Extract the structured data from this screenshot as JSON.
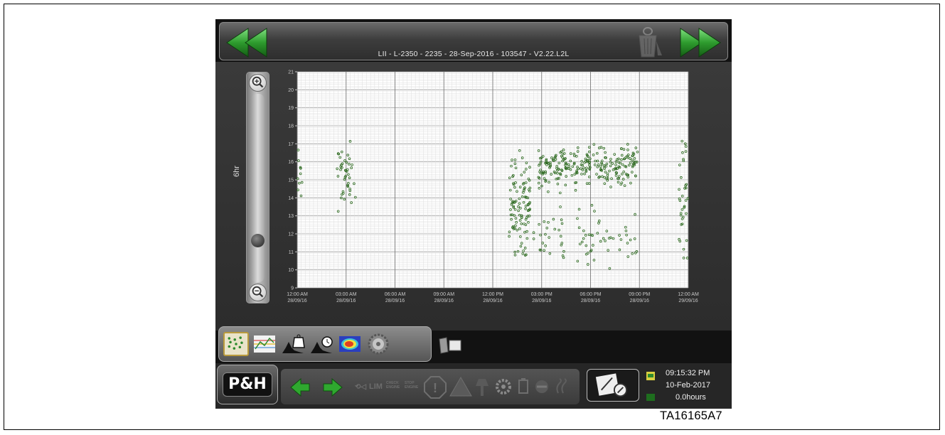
{
  "header": {
    "title": "LII - L-2350 - 2235 - 28-Sep-2016 - 103547 - V2.22.L2L",
    "icons": [
      "arrow-left-icon",
      "trash-icon",
      "arrow-right-icon"
    ]
  },
  "zoom": {
    "label": "6hr",
    "level": 0.8
  },
  "chart_data": {
    "type": "scatter",
    "title": "",
    "xlabel": "",
    "ylabel": "",
    "ylim": [
      9,
      21
    ],
    "y_ticks": [
      "9",
      "10",
      "11",
      "12",
      "13",
      "14",
      "15",
      "16",
      "17",
      "18",
      "19",
      "20",
      "21"
    ],
    "x_ticks": [
      {
        "time": "12:00 AM",
        "date": "28/09/16"
      },
      {
        "time": "03:00 AM",
        "date": "28/09/16"
      },
      {
        "time": "06:00 AM",
        "date": "28/09/16"
      },
      {
        "time": "09:00 AM",
        "date": "28/09/16"
      },
      {
        "time": "12:00 PM",
        "date": "28/09/16"
      },
      {
        "time": "03:00 PM",
        "date": "28/09/16"
      },
      {
        "time": "06:00 PM",
        "date": "28/09/16"
      },
      {
        "time": "09:00 PM",
        "date": "28/09/16"
      },
      {
        "time": "12:00 AM",
        "date": "29/09/16"
      }
    ],
    "xlim_hours": [
      0,
      24
    ],
    "grid": true,
    "marker_color": "#2f6b22",
    "clusters": [
      {
        "x_range": [
          0.0,
          0.3
        ],
        "y_range": [
          12.4,
          17.5
        ],
        "count": 10
      },
      {
        "x_range": [
          2.4,
          3.6
        ],
        "y_range": [
          12.6,
          17.8
        ],
        "count": 45
      },
      {
        "x_range": [
          13.0,
          14.3
        ],
        "y_range": [
          9.6,
          17.4
        ],
        "count": 110
      },
      {
        "x_range": [
          14.8,
          17.3
        ],
        "y_range": [
          14.0,
          17.4
        ],
        "count": 110
      },
      {
        "x_range": [
          17.3,
          20.9
        ],
        "y_range": [
          14.4,
          17.3
        ],
        "count": 150
      },
      {
        "x_range": [
          14.4,
          20.9
        ],
        "y_range": [
          9.4,
          14.1
        ],
        "count": 75
      },
      {
        "x_range": [
          23.4,
          24.0
        ],
        "y_range": [
          9.4,
          18.4
        ],
        "count": 35
      }
    ]
  },
  "toolbar": {
    "buttons": [
      "scatter-plot-icon",
      "line-trend-icon",
      "histogram-weight-icon",
      "histogram-time-icon",
      "heatmap-icon",
      "gear-icon",
      "copy-icon"
    ]
  },
  "footer": {
    "logo": "P&H",
    "ghost_labels": {
      "lim": "LIM",
      "check_engine": "CHECK ENGINE",
      "stop_engine": "STOP ENGINE"
    },
    "time": "09:15:32 PM",
    "date": "10-Feb-2017",
    "hours": "0.0hours"
  },
  "caption": "TA16165A7",
  "colors": {
    "screen_bg": "#121212",
    "nav_green": "#2e9b2e",
    "accent_gold": "#b99a3c"
  }
}
